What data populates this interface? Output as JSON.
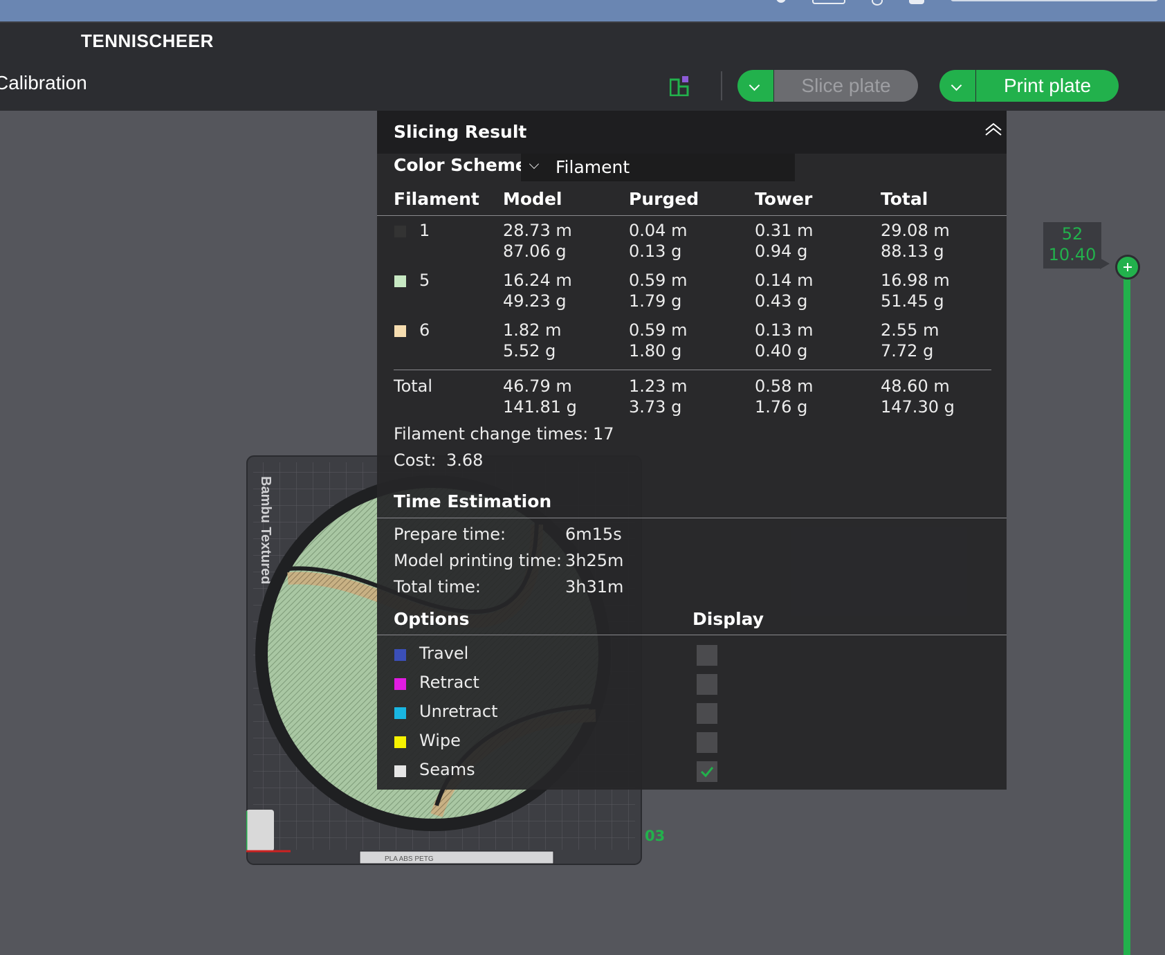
{
  "app": {
    "title": "TENNISCHEER",
    "tab_label": "Calibration"
  },
  "toolbar": {
    "slice_label": "Slice plate",
    "print_label": "Print plate",
    "layout_icon": "layout-icon"
  },
  "panel": {
    "title": "Slicing Result",
    "color_scheme_label": "Color Scheme",
    "color_scheme_value": "Filament",
    "columns": [
      "Filament",
      "Model",
      "Purged",
      "Tower",
      "Total"
    ],
    "rows": [
      {
        "id": "1",
        "color": "#333333",
        "model": [
          "28.73 m",
          "87.06 g"
        ],
        "purged": [
          "0.04 m",
          "0.13 g"
        ],
        "tower": [
          "0.31 m",
          "0.94 g"
        ],
        "total": [
          "29.08 m",
          "88.13 g"
        ]
      },
      {
        "id": "5",
        "color": "#c7e8c3",
        "model": [
          "16.24 m",
          "49.23 g"
        ],
        "purged": [
          "0.59 m",
          "1.79 g"
        ],
        "tower": [
          "0.14 m",
          "0.43 g"
        ],
        "total": [
          "16.98 m",
          "51.45 g"
        ]
      },
      {
        "id": "6",
        "color": "#f6ddb0",
        "model": [
          "1.82 m",
          "5.52 g"
        ],
        "purged": [
          "0.59 m",
          "1.80 g"
        ],
        "tower": [
          "0.13 m",
          "0.40 g"
        ],
        "total": [
          "2.55 m",
          "7.72 g"
        ]
      }
    ],
    "total_row": {
      "label": "Total",
      "model": [
        "46.79 m",
        "141.81 g"
      ],
      "purged": [
        "1.23 m",
        "3.73 g"
      ],
      "tower": [
        "0.58 m",
        "1.76 g"
      ],
      "total": [
        "48.60 m",
        "147.30 g"
      ]
    },
    "filament_change_label": "Filament change times:",
    "filament_change_value": "17",
    "cost_label": "Cost:",
    "cost_value": "3.68",
    "time_title": "Time Estimation",
    "prepare_label": "Prepare time:",
    "prepare_value": "6m15s",
    "model_time_label": "Model printing time:",
    "model_time_value": "3h25m",
    "total_time_label": "Total time:",
    "total_time_value": "3h31m",
    "options_title": "Options",
    "display_title": "Display",
    "options": [
      {
        "label": "Travel",
        "color": "#3b4fb8",
        "checked": false
      },
      {
        "label": "Retract",
        "color": "#e21ce2",
        "checked": false
      },
      {
        "label": "Unretract",
        "color": "#19b6e2",
        "checked": false
      },
      {
        "label": "Wipe",
        "color": "#f6f200",
        "checked": false
      },
      {
        "label": "Seams",
        "color": "#e6e6e6",
        "checked": true
      }
    ]
  },
  "slider": {
    "layer": "52",
    "height": "10.40"
  },
  "plate": {
    "label": "Bambu Textured",
    "number": "03",
    "bottom_text": "PLA ABS PETG"
  }
}
